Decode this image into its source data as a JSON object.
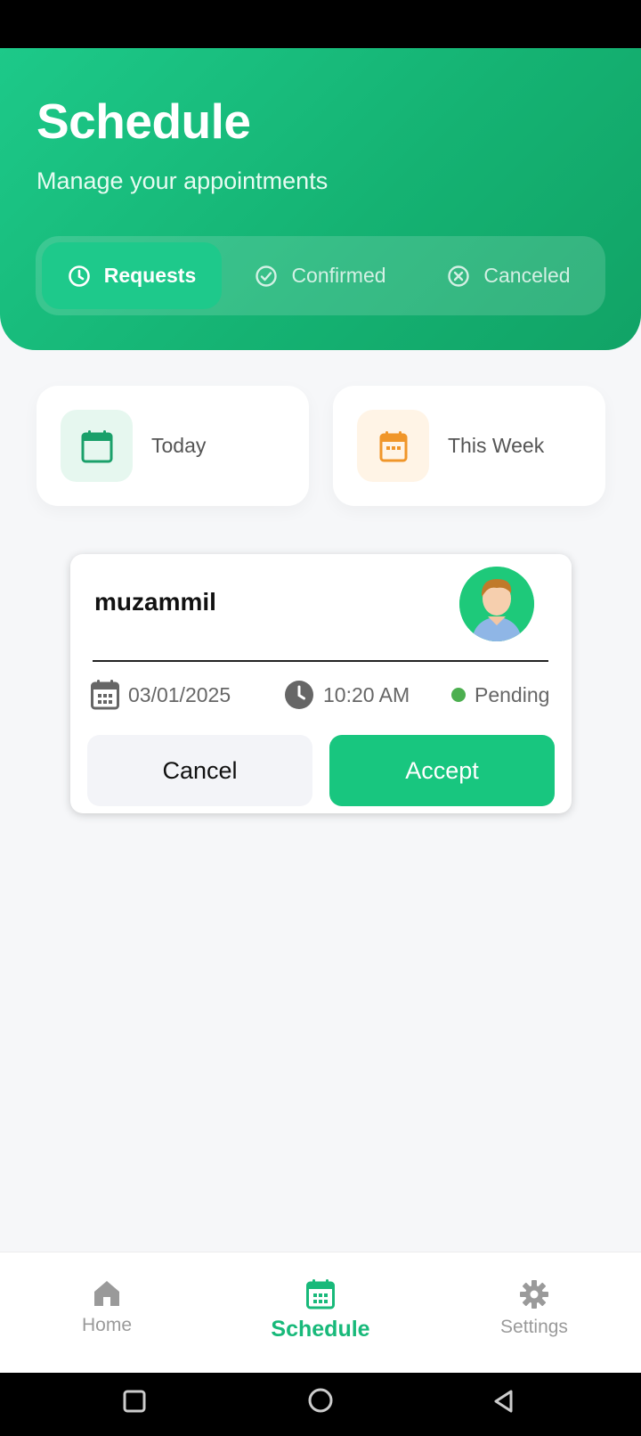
{
  "header": {
    "title": "Schedule",
    "subtitle": "Manage your appointments",
    "tabs": [
      {
        "label": "Requests",
        "icon": "clock-icon",
        "active": true
      },
      {
        "label": "Confirmed",
        "icon": "check-circle-icon",
        "active": false
      },
      {
        "label": "Canceled",
        "icon": "x-circle-icon",
        "active": false
      }
    ]
  },
  "summary": [
    {
      "label": "Today",
      "icon": "calendar-icon",
      "color": "#1aa06a",
      "bg": "#e6f7ef"
    },
    {
      "label": "This Week",
      "icon": "calendar-week-icon",
      "color": "#f0962a",
      "bg": "#fff4e6"
    }
  ],
  "appointment": {
    "name": "muzammil",
    "date": "03/01/2025",
    "time": "10:20 AM",
    "status": "Pending",
    "status_color": "#4caf50",
    "cancel_label": "Cancel",
    "accept_label": "Accept"
  },
  "bottom_nav": [
    {
      "label": "Home",
      "icon": "home-icon",
      "active": false
    },
    {
      "label": "Schedule",
      "icon": "calendar-icon",
      "active": true
    },
    {
      "label": "Settings",
      "icon": "gear-icon",
      "active": false
    }
  ],
  "colors": {
    "accent": "#18c67f",
    "header_start": "#1dc989",
    "header_end": "#11a366"
  }
}
